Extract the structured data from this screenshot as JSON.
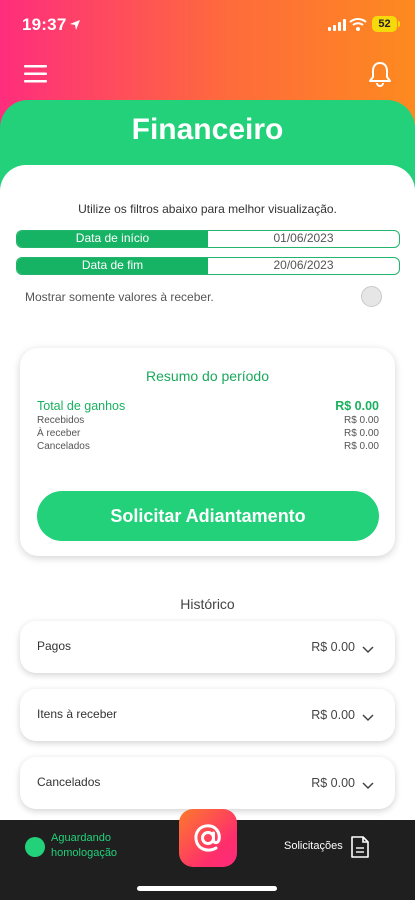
{
  "status_bar": {
    "time": "19:37",
    "battery": "52"
  },
  "header": {
    "title": "Financeiro"
  },
  "filters": {
    "hint": "Utilize os filtros abaixo para melhor visualização.",
    "start_label": "Data de início",
    "start_value": "01/06/2023",
    "end_label": "Data de fim",
    "end_value": "20/06/2023",
    "toggle_label": "Mostrar somente valores à receber."
  },
  "summary": {
    "title": "Resumo do período",
    "rows": [
      {
        "label": "Total de ganhos",
        "value": "R$ 0.00"
      },
      {
        "label": "Recebidos",
        "value": "R$ 0.00"
      },
      {
        "label": "À receber",
        "value": "R$ 0.00"
      },
      {
        "label": "Cancelados",
        "value": "R$ 0.00"
      }
    ],
    "button_label": "Solicitar Adiantamento"
  },
  "history": {
    "title": "Histórico",
    "items": [
      {
        "label": "Pagos",
        "value": "R$ 0.00"
      },
      {
        "label": "Itens à receber",
        "value": "R$ 0.00"
      },
      {
        "label": "Cancelados",
        "value": "R$ 0.00"
      }
    ]
  },
  "bottom_bar": {
    "status_text": "Aguardando homologação",
    "requests_label": "Solicitações"
  },
  "colors": {
    "accent_green": "#22d17a",
    "gradient_start": "#fe2d7d",
    "gradient_end": "#fd8a1f"
  }
}
